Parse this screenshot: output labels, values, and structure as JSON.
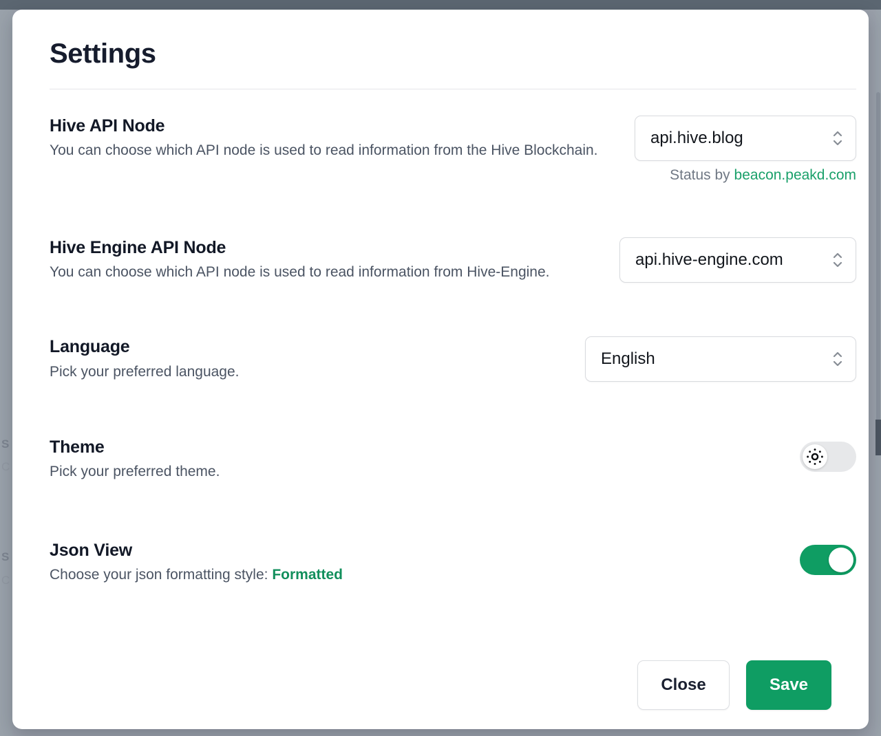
{
  "modal": {
    "title": "Settings",
    "settings": [
      {
        "id": "hive-api",
        "title": "Hive API Node",
        "description": "You can choose which API node is used to read information from the Hive Blockchain.",
        "control": "select",
        "value": "api.hive.blog",
        "status_prefix": "Status by",
        "status_link": "beacon.peakd.com"
      },
      {
        "id": "hive-engine-api",
        "title": "Hive Engine API Node",
        "description": "You can choose which API node is used to read information from Hive-Engine.",
        "control": "select",
        "value": "api.hive-engine.com"
      },
      {
        "id": "language",
        "title": "Language",
        "description": "Pick your preferred language.",
        "control": "select",
        "value": "English"
      },
      {
        "id": "theme",
        "title": "Theme",
        "description": "Pick your preferred theme.",
        "control": "toggle",
        "state": "off",
        "icon": "sun-icon"
      },
      {
        "id": "json-view",
        "title": "Json View",
        "description": "Choose your json formatting style: ",
        "description_highlight": "Formatted",
        "control": "toggle",
        "state": "on"
      }
    ],
    "footer": {
      "close_label": "Close",
      "save_label": "Save"
    }
  },
  "colors": {
    "accent_green": "#0f9d63",
    "link_green": "#1aa06a",
    "title_dark": "#161c2d",
    "desc_gray": "#4b5463",
    "backdrop_slate": "#5b6671",
    "toggle_off": "#e7e8ea"
  },
  "backdrop": {
    "ghosts": [
      "S",
      "C",
      "S",
      "C"
    ]
  }
}
